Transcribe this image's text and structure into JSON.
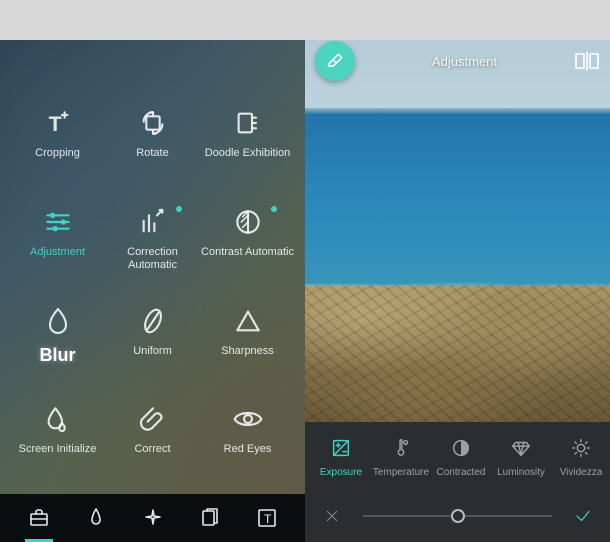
{
  "colors": {
    "accent": "#3dd4c4",
    "panel": "#2a2e30",
    "tabbar": "#0a0e10"
  },
  "left": {
    "tools": [
      {
        "label": "Cropping",
        "icon": "crop"
      },
      {
        "label": "Rotate",
        "icon": "rotate"
      },
      {
        "label": "Doodle Exhibition",
        "icon": "doodle"
      },
      {
        "label": "Adjustment",
        "icon": "sliders",
        "highlight": true
      },
      {
        "label": "Correction Automatic",
        "icon": "auto-correct",
        "badge": true
      },
      {
        "label": "Contrast Automatic",
        "icon": "contrast",
        "badge": true
      },
      {
        "label": "Blur",
        "icon": "blur",
        "large": true
      },
      {
        "label": "Uniform",
        "icon": "feather"
      },
      {
        "label": "Sharpness",
        "icon": "triangle"
      },
      {
        "label": "Screen Initialize",
        "icon": "drop"
      },
      {
        "label": "Correct",
        "icon": "clip"
      },
      {
        "label": "Red Eyes",
        "icon": "eye"
      }
    ],
    "tabs": [
      {
        "name": "toolbox",
        "active": true
      },
      {
        "name": "brush",
        "active": false
      },
      {
        "name": "effects",
        "active": false
      },
      {
        "name": "layers",
        "active": false
      },
      {
        "name": "text",
        "active": false
      }
    ]
  },
  "right": {
    "title": "Adjustment",
    "adjustments": [
      {
        "label": "Exposure",
        "icon": "exposure",
        "selected": true
      },
      {
        "label": "Temperature",
        "icon": "thermometer"
      },
      {
        "label": "Contracted",
        "icon": "contrast-circle"
      },
      {
        "label": "Luminosity",
        "icon": "diamond"
      },
      {
        "label": "Vividezza",
        "icon": "sun"
      }
    ],
    "slider": {
      "value": 50,
      "min": 0,
      "max": 100
    }
  }
}
